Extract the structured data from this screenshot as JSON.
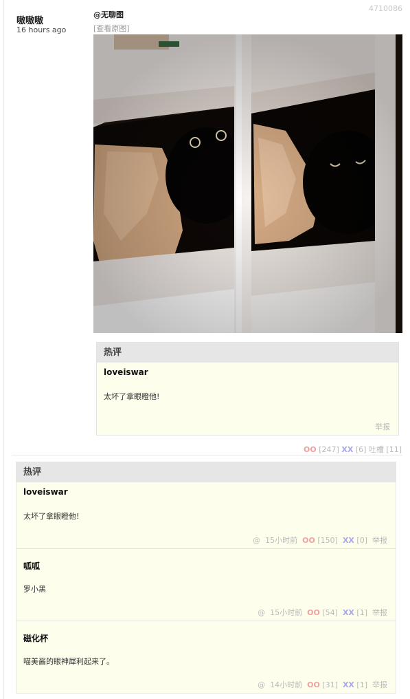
{
  "post": {
    "id": "4710086",
    "author": "嗷嗷嗷",
    "time": "16 hours ago",
    "mention": "@无聊图",
    "view_original": "[查看原图]",
    "vote_oo_label": "OO",
    "vote_oo_count": "[247]",
    "vote_xx_label": "XX",
    "vote_xx_count": "[6]",
    "tucao_label": "吐槽",
    "tucao_count": "[11]"
  },
  "inner_hot": {
    "title": "热评",
    "comment": {
      "name": "loveiswar",
      "text": "太坏了拿眼瞪他!",
      "report": "举报"
    }
  },
  "hot_comments": {
    "title": "热评",
    "items": [
      {
        "name": "loveiswar",
        "text": "太坏了拿眼瞪他!",
        "at": "@",
        "time": "15小时前",
        "oo": "OO",
        "oo_count": "[150]",
        "xx": "XX",
        "xx_count": "[0]",
        "report": "举报"
      },
      {
        "name": "呱呱",
        "text": "罗小黑",
        "at": "@",
        "time": "15小时前",
        "oo": "OO",
        "oo_count": "[54]",
        "xx": "XX",
        "xx_count": "[1]",
        "report": "举报"
      },
      {
        "name": "磁化杯",
        "text": "喵美酱的眼神犀利起来了。",
        "at": "@",
        "time": "14小时前",
        "oo": "OO",
        "oo_count": "[31]",
        "xx": "XX",
        "xx_count": "[1]",
        "report": "举报"
      }
    ]
  }
}
